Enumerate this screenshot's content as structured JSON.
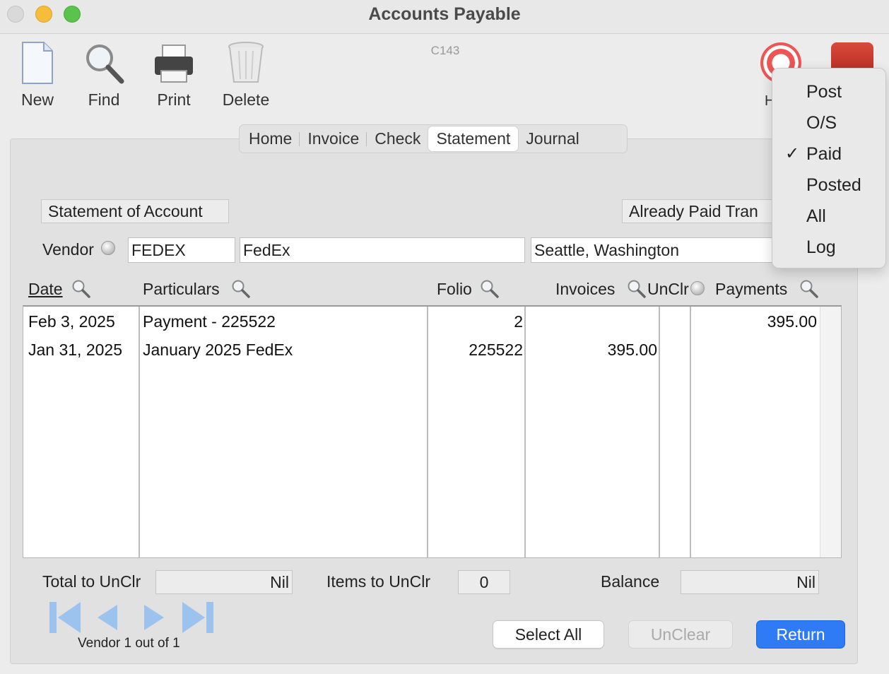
{
  "window": {
    "title": "Accounts Payable"
  },
  "form_code": "C143",
  "toolbar": {
    "new_label": "New",
    "find_label": "Find",
    "print_label": "Print",
    "delete_label": "Delete",
    "help_label": "H"
  },
  "tabs": [
    "Home",
    "Invoice",
    "Check",
    "Statement",
    "Journal"
  ],
  "active_tab": "Statement",
  "section_title": "Statement of Account",
  "filter_label": "Already Paid Tran",
  "vendor": {
    "label": "Vendor",
    "code": "FEDEX",
    "name": "FedEx",
    "location": "Seattle, Washington"
  },
  "columns": {
    "date": "Date",
    "particulars": "Particulars",
    "folio": "Folio",
    "invoices": "Invoices",
    "unclr": "UnClr",
    "payments": "Payments"
  },
  "rows": [
    {
      "date": "Feb 3, 2025",
      "particulars": "Payment - 225522",
      "folio": "2",
      "invoices": "",
      "unclr": "",
      "payments": "395.00"
    },
    {
      "date": "Jan 31, 2025",
      "particulars": "January 2025 FedEx",
      "folio": "225522",
      "invoices": "395.00",
      "unclr": "",
      "payments": ""
    }
  ],
  "totals": {
    "total_unclr_label": "Total to UnClr",
    "total_unclr_value": "Nil",
    "items_unclr_label": "Items to UnClr",
    "items_unclr_value": "0",
    "balance_label": "Balance",
    "balance_value": "Nil"
  },
  "navigation": {
    "record_label": "Vendor 1 out of 1"
  },
  "buttons": {
    "select_all": "Select All",
    "unclear": "UnClear",
    "return": "Return"
  },
  "dropdown": {
    "items": [
      "Post",
      "O/S",
      "Paid",
      "Posted",
      "All",
      "Log"
    ],
    "checked": "Paid",
    "check_mark": "✓"
  },
  "colors": {
    "primary_button": "#2f7bf5",
    "close_light": "#d9d9d9",
    "minimize_light": "#f6bd3b",
    "maximize_light": "#5ac34b"
  },
  "icons": [
    "new-document-icon",
    "find-magnifier-icon",
    "printer-icon",
    "trash-icon",
    "help-lifebuoy-icon",
    "power-icon",
    "sort-magnifier-icon"
  ]
}
